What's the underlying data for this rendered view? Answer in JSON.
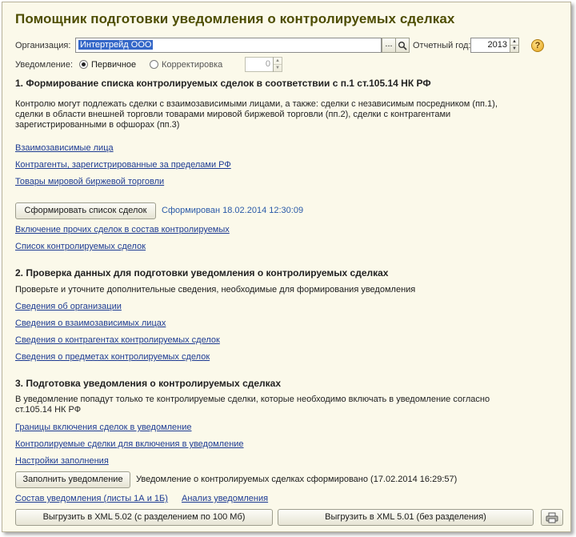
{
  "title": "Помощник подготовки уведомления о контролируемых сделках",
  "org": {
    "label": "Организация:",
    "value": "Интертрейд ООО",
    "select_btn": "...",
    "search_icon": "search-icon"
  },
  "year": {
    "label": "Отчетный год:",
    "value": "2013"
  },
  "help_icon": "?",
  "notice": {
    "label": "Уведомление:",
    "primary": "Первичное",
    "correction": "Корректировка",
    "number": "0"
  },
  "section1": {
    "heading": "1. Формирование списка контролируемых сделок в соответствии с п.1 ст.105.14 НК РФ",
    "text_line1": "Контролю могут подлежать сделки с взаимозависимыми лицами, а также: сделки с независимым посредником (пп.1),",
    "text_line2": "сделки в области внешней торговли товарами мировой биржевой торговли (пп.2), сделки с контрагентами",
    "text_line3": "зарегистрированными в офшорах (пп.3)",
    "links": [
      "Взаимозависимые лица",
      "Контрагенты, зарегистрированные за пределами РФ",
      "Товары мировой биржевой торговли"
    ],
    "button": "Сформировать список сделок",
    "status": "Сформирован 18.02.2014 12:30:09",
    "links2": [
      "Включение прочих сделок в состав контролируемых",
      "Список контролируемых сделок"
    ]
  },
  "section2": {
    "heading": "2. Проверка данных для подготовки уведомления о контролируемых сделках",
    "text": "Проверьте и уточните дополнительные сведения, необходимые для формирования уведомления",
    "links": [
      "Сведения об организации",
      "Сведения о взаимозависимых лицах",
      "Сведения о контрагентах контролируемых сделок",
      "Сведения о предметах контролируемых сделок"
    ]
  },
  "section3": {
    "heading": "3. Подготовка уведомления о контролируемых сделках",
    "text_line1": "В уведомление попадут только те контролируемые сделки, которые необходимо включать в уведомление согласно",
    "text_line2": "ст.105.14 НК РФ",
    "links": [
      "Границы включения сделок в уведомление",
      "Контролируемые сделки для включения в уведомление",
      "Настройки заполнения"
    ],
    "button": "Заполнить уведомление",
    "status": "Уведомление о контролируемых сделках сформировано (17.02.2014 16:29:57)",
    "link_composition": "Состав уведомления (листы 1А и 1Б)",
    "link_analysis": "Анализ уведомления"
  },
  "export": {
    "xml502": "Выгрузить в XML 5.02 (с разделением по 100 Мб)",
    "xml501": "Выгрузить в XML 5.01 (без разделения)",
    "print_icon": "printer-icon"
  }
}
